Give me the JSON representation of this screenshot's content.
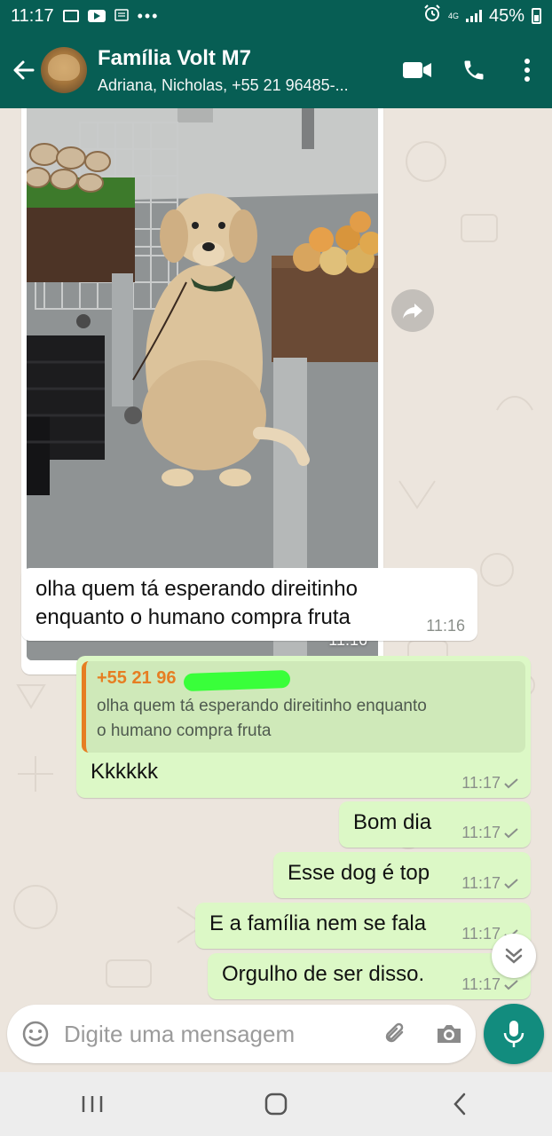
{
  "status_bar": {
    "time": "11:17",
    "network": "4G",
    "battery": "45%",
    "icons": [
      "gallery-icon",
      "youtube-icon",
      "notification-icon",
      "more-dots-icon",
      "alarm-icon",
      "signal-icon",
      "battery-icon"
    ]
  },
  "header": {
    "title": "Família Volt M7",
    "subtitle": "Adriana, Nicholas, +55 21 96485-...",
    "icons": [
      "back-arrow-icon",
      "video-call-icon",
      "phone-icon",
      "more-vert-icon"
    ]
  },
  "messages": [
    {
      "type": "image",
      "direction": "incoming",
      "time": "11:16"
    },
    {
      "type": "text",
      "direction": "incoming",
      "lines": [
        "olha quem tá esperando direitinho",
        "enquanto o humano compra fruta"
      ],
      "time": "11:16"
    },
    {
      "type": "reply",
      "direction": "outgoing",
      "quote_sender": "+55 21 96",
      "quote_lines": [
        "olha quem tá esperando direitinho enquanto",
        "o humano compra fruta"
      ],
      "text": "Kkkkkk",
      "time": "11:17"
    },
    {
      "type": "text",
      "direction": "outgoing",
      "text": "Bom dia",
      "time": "11:17"
    },
    {
      "type": "text",
      "direction": "outgoing",
      "text": "Esse dog é top",
      "time": "11:17"
    },
    {
      "type": "text",
      "direction": "outgoing",
      "text": "E a família nem se fala",
      "time": "11:17"
    },
    {
      "type": "text",
      "direction": "outgoing",
      "text": "Orgulho de ser disso.",
      "time": "11:17"
    }
  ],
  "input": {
    "placeholder": "Digite uma mensagem"
  },
  "colors": {
    "header": "#075e54",
    "accent": "#128c7e",
    "outgoing_bubble": "#dcf8c6",
    "incoming_bubble": "#ffffff",
    "chat_background": "#ece5dd",
    "quote_sender": "#e67e22"
  }
}
